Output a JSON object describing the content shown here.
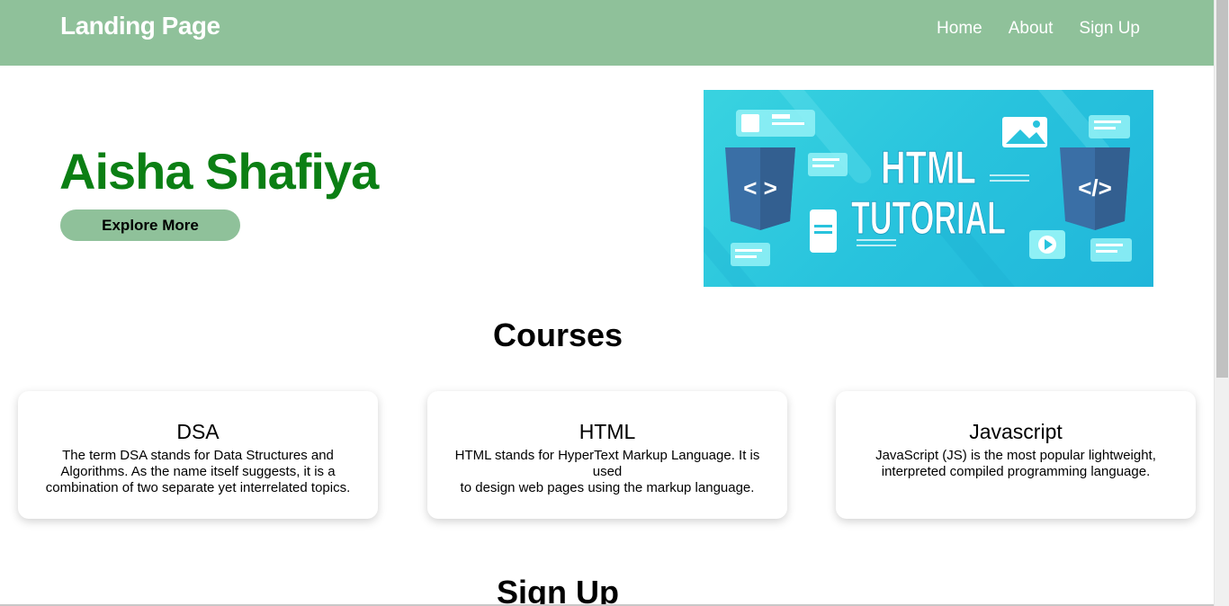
{
  "navbar": {
    "brand": "Landing Page",
    "links": [
      "Home",
      "About",
      "Sign Up"
    ]
  },
  "hero": {
    "name": "Aisha Shafiya",
    "button_label": "Explore More",
    "image": {
      "title_line1": "HTML",
      "title_line2": "TUTORIAL",
      "left_badge": "< >",
      "right_badge": "</>"
    }
  },
  "courses": {
    "title": "Courses",
    "items": [
      {
        "title": "DSA",
        "lines": [
          "The term DSA stands for Data Structures and",
          "Algorithms. As the name itself suggests, it is a",
          "combination of two separate yet interrelated topics."
        ]
      },
      {
        "title": "HTML",
        "lines": [
          "HTML stands for HyperText Markup Language. It is used",
          "to design web pages using the markup language."
        ]
      },
      {
        "title": "Javascript",
        "lines": [
          "JavaScript (JS) is the most popular lightweight,",
          "interpreted compiled programming language."
        ]
      }
    ]
  },
  "signup": {
    "title": "Sign Up"
  },
  "colors": {
    "navbar": "#8fc19a",
    "hero_name": "#0b7f14",
    "image_bg": "#28c3dd",
    "badge": "#3a6fa6"
  }
}
